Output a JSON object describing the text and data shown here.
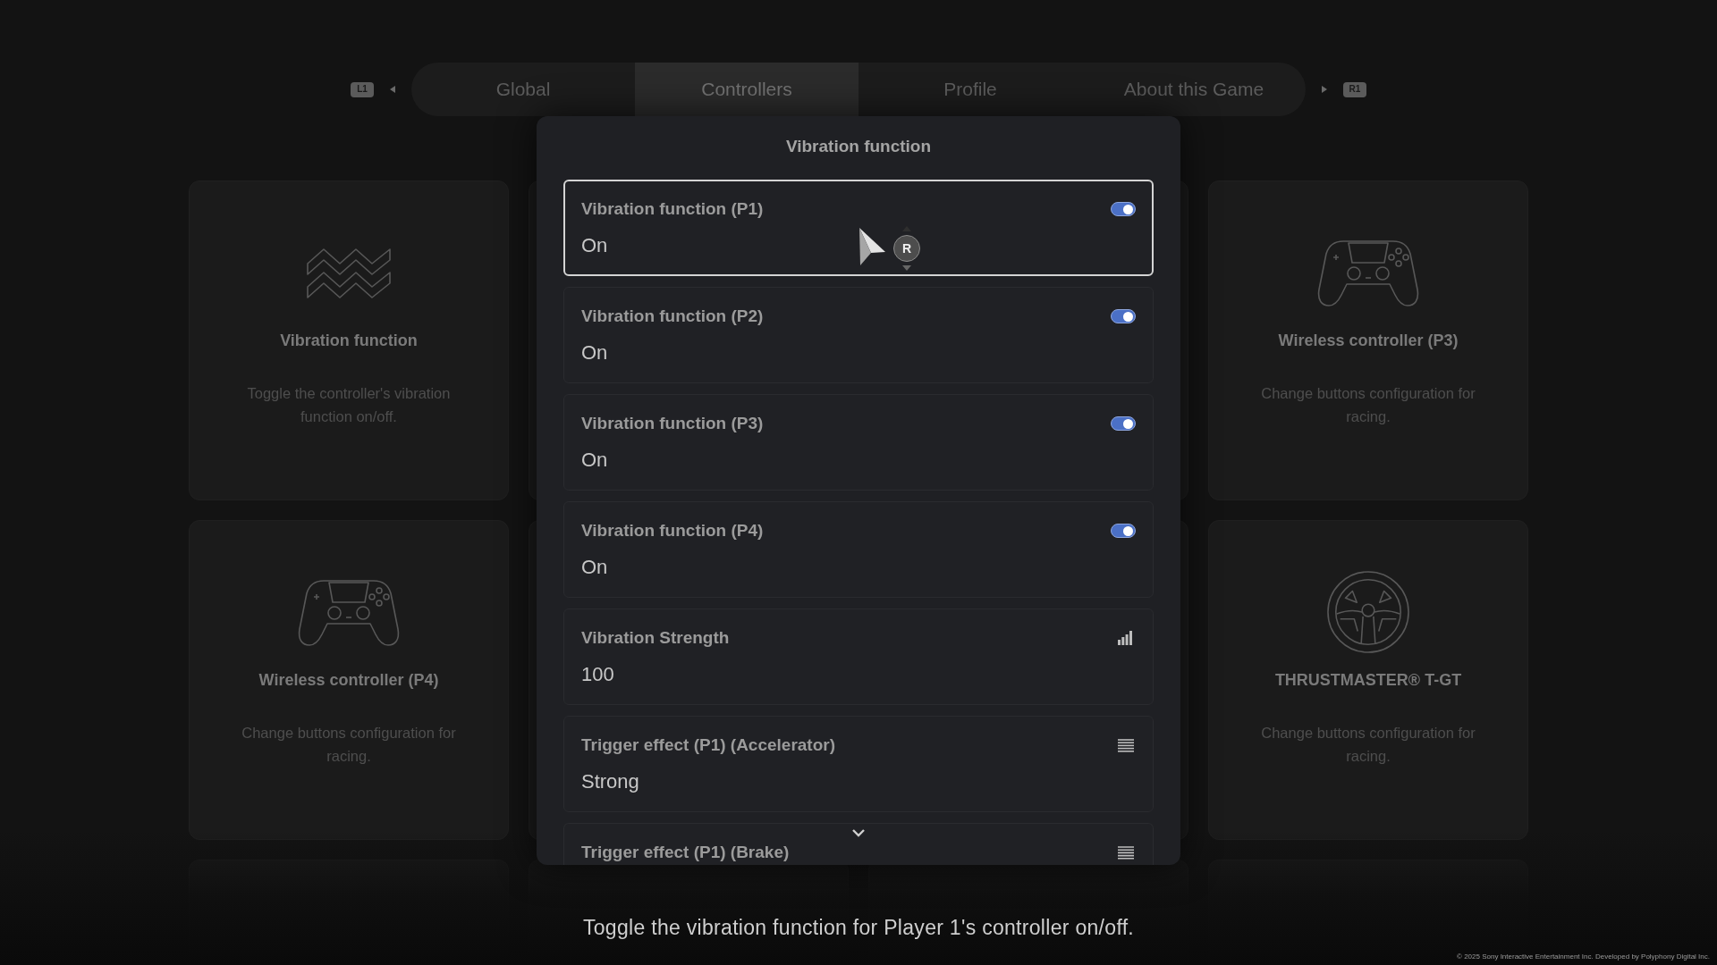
{
  "tab_bar": {
    "left_button": "L1",
    "right_button": "R1",
    "tabs": [
      {
        "label": "Global",
        "selected": false
      },
      {
        "label": "Controllers",
        "selected": true
      },
      {
        "label": "Profile",
        "selected": false
      },
      {
        "label": "About this Game",
        "selected": false
      }
    ]
  },
  "cards": [
    {
      "kind": "waves",
      "title": "Vibration function",
      "description": "Toggle the controller's vibration function on/off."
    },
    {
      "kind": "blank"
    },
    {
      "kind": "blank"
    },
    {
      "kind": "gamepad",
      "title": "Wireless controller (P3)",
      "description": "Change buttons configuration for racing."
    },
    {
      "kind": "gamepad",
      "title": "Wireless controller (P4)",
      "description": "Change buttons configuration for racing."
    },
    {
      "kind": "blank"
    },
    {
      "kind": "blank"
    },
    {
      "kind": "wheel",
      "title": "THRUSTMASTER® T-GT",
      "description": "Change buttons configuration for racing."
    },
    {
      "kind": "blank"
    },
    {
      "kind": "blank"
    },
    {
      "kind": "blank"
    },
    {
      "kind": "blank"
    }
  ],
  "dialog": {
    "title": "Vibration function",
    "rows": [
      {
        "kind": "toggle",
        "label": "Vibration function (P1)",
        "value": "On",
        "on": true,
        "selected": true
      },
      {
        "kind": "toggle",
        "label": "Vibration function (P2)",
        "value": "On",
        "on": true,
        "selected": false
      },
      {
        "kind": "toggle",
        "label": "Vibration function (P3)",
        "value": "On",
        "on": true,
        "selected": false
      },
      {
        "kind": "toggle",
        "label": "Vibration function (P4)",
        "value": "On",
        "on": true,
        "selected": false
      },
      {
        "kind": "strength",
        "label": "Vibration Strength",
        "value": "100",
        "selected": false
      },
      {
        "kind": "list",
        "label": "Trigger effect (P1) (Accelerator)",
        "value": "Strong",
        "selected": false
      },
      {
        "kind": "list",
        "label": "Trigger effect (P1) (Brake)",
        "selected": false
      }
    ]
  },
  "cursor": {
    "badge": "R"
  },
  "help_text": "Toggle the vibration function for Player 1's controller on/off.",
  "copyright": "© 2025 Sony Interactive Entertainment Inc. Developed by Polyphony Digital Inc."
}
